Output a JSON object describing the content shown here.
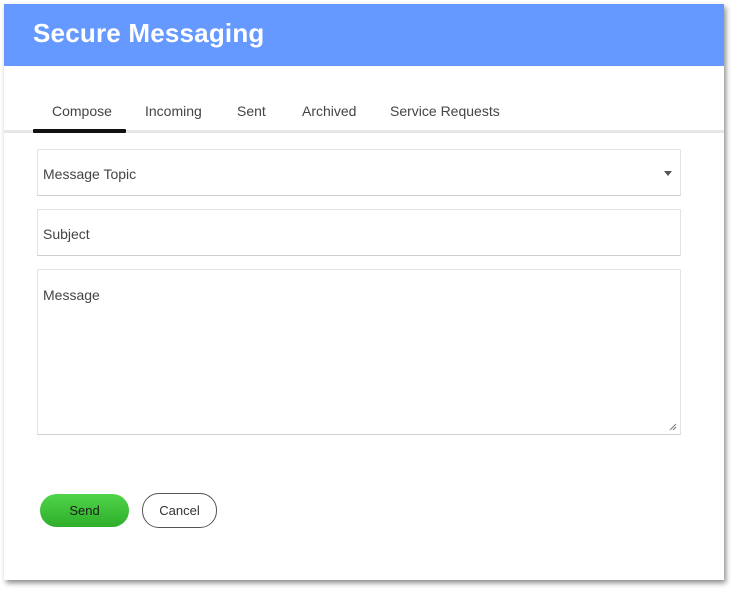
{
  "app": {
    "title": "Secure Messaging",
    "accent_color": "#6699ff"
  },
  "tabs": [
    {
      "label": "Compose",
      "active": true
    },
    {
      "label": "Incoming",
      "active": false
    },
    {
      "label": "Sent",
      "active": false
    },
    {
      "label": "Archived",
      "active": false
    },
    {
      "label": "Service Requests",
      "active": false
    }
  ],
  "form": {
    "topic": {
      "placeholder": "Message Topic",
      "value": "",
      "icon": "caret-down-icon"
    },
    "subject": {
      "placeholder": "Subject",
      "value": ""
    },
    "message": {
      "placeholder": "Message",
      "value": "",
      "icon": "resize-handle-icon"
    }
  },
  "buttons": {
    "send_label": "Send",
    "send_color": "#3cc236",
    "cancel_label": "Cancel"
  }
}
